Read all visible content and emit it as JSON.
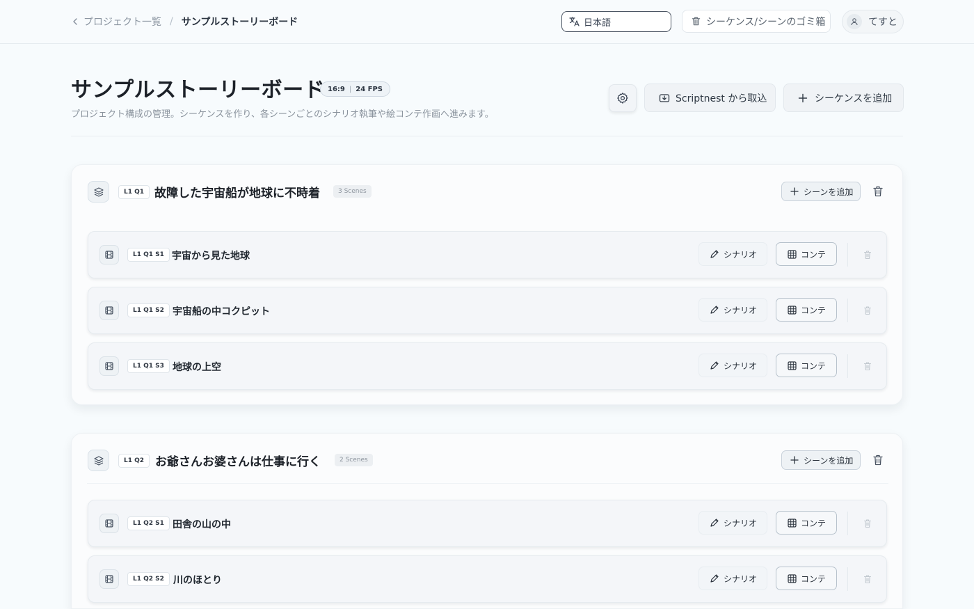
{
  "breadcrumb": {
    "back_label": "プロジェクト一覧",
    "separator": "/",
    "current": "サンプルストーリーボード"
  },
  "topbar": {
    "language_value": "日本語",
    "trash_label": "シーケンス/シーンのゴミ箱",
    "user_name": "てすと"
  },
  "header": {
    "title": "サンプルストーリーボード",
    "aspect_ratio": "16:9",
    "fps": "24 FPS",
    "description": "プロジェクト構成の管理。シーケンスを作り、各シーンごとのシナリオ執筆や絵コンテ作画へ進みます。",
    "import_label": "Scriptnest から取込",
    "add_sequence_label": "シーケンスを追加"
  },
  "sequences": [
    {
      "code": "L1 Q1",
      "title": "故障した宇宙船が地球に不時着",
      "count": "3 Scenes",
      "add_scene_label": "シーンを追加",
      "scenes": [
        {
          "code": "L1 Q1 S1",
          "title": "宇宙から見た地球",
          "scenario_label": "シナリオ",
          "conte_label": "コンテ"
        },
        {
          "code": "L1 Q1 S2",
          "title": "宇宙船の中コクピット",
          "scenario_label": "シナリオ",
          "conte_label": "コンテ"
        },
        {
          "code": "L1 Q1 S3",
          "title": "地球の上空",
          "scenario_label": "シナリオ",
          "conte_label": "コンテ"
        }
      ]
    },
    {
      "code": "L1 Q2",
      "title": "お爺さんお婆さんは仕事に行く",
      "count": "2 Scenes",
      "add_scene_label": "シーンを追加",
      "scenes": [
        {
          "code": "L1 Q2 S1",
          "title": "田舎の山の中",
          "scenario_label": "シナリオ",
          "conte_label": "コンテ"
        },
        {
          "code": "L1 Q2 S2",
          "title": "川のほとり",
          "scenario_label": "シナリオ",
          "conte_label": "コンテ"
        }
      ]
    }
  ]
}
